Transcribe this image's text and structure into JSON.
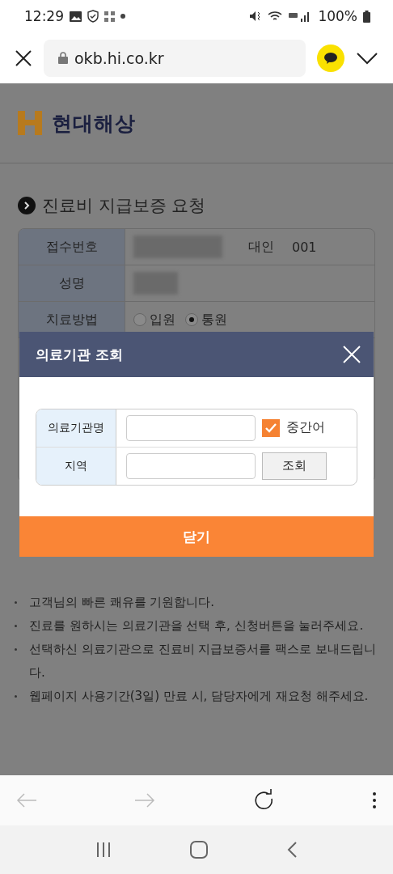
{
  "status_bar": {
    "time": "12:29",
    "battery": "100%"
  },
  "browser": {
    "url": "okb.hi.co.kr"
  },
  "page": {
    "logo_text": "현대해상",
    "heading": "진료비 지급보증 요청",
    "form_rows": [
      {
        "kind": "text",
        "label": "접수번호",
        "values": [
          "대인",
          "001"
        ]
      },
      {
        "kind": "text",
        "label": "성명",
        "values": []
      },
      {
        "kind": "radio",
        "label": "치료방법",
        "options": [
          {
            "label": "입원",
            "selected": false
          },
          {
            "label": "통원",
            "selected": true
          }
        ]
      }
    ],
    "notes": [
      "고객님의 빠른 쾌유를 기원합니다.",
      "진료를 원하시는 의료기관을 선택 후, 신청버튼을 눌러주세요.",
      "선택하신 의료기관으로 진료비 지급보증서를 팩스로 보내드립니다.",
      "웹페이지 사용기간(3일) 만료 시, 담당자에게 재요청 해주세요."
    ]
  },
  "modal": {
    "title": "의료기관 조회",
    "fields": [
      {
        "kind": "checkbox",
        "label": "의료기관명",
        "option": {
          "label": "중간어",
          "checked": true
        }
      },
      {
        "kind": "button",
        "label": "지역",
        "button": "조회"
      }
    ],
    "close_button": "닫기"
  }
}
